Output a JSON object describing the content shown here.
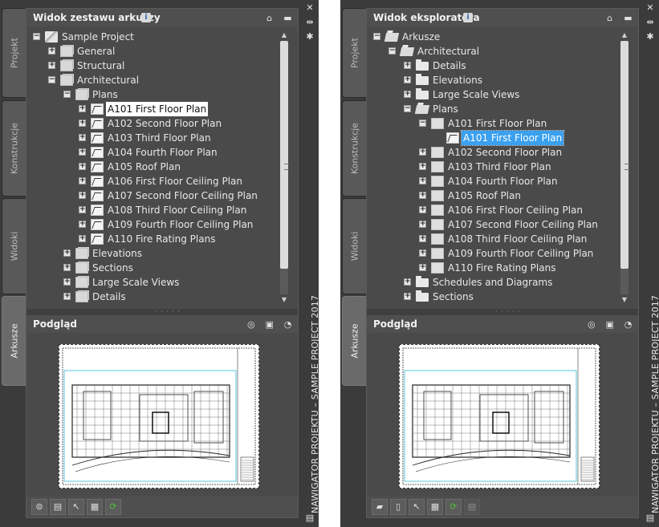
{
  "left": {
    "side_tabs": [
      "Projekt",
      "Konstrukcje",
      "Widoki",
      "Arkusze"
    ],
    "active_tab": "Arkusze",
    "title_vertical": "NAWIGATOR PROJEKTU – SAMPLE PROJECT 2017",
    "sheetset_panel": {
      "title": "Widok zestawu arkuszy",
      "info": "i",
      "tree": [
        {
          "label": "Sample Project",
          "icon": "sheetset-icon",
          "expanded": true
        },
        {
          "label": "General",
          "icon": "subset-icon",
          "expanded": false
        },
        {
          "label": "Structural",
          "icon": "subset-icon",
          "expanded": false
        },
        {
          "label": "Architectural",
          "icon": "subset-icon",
          "expanded": true
        },
        {
          "label": "Plans",
          "icon": "subset-icon",
          "expanded": true
        },
        {
          "label": "A101 First Floor Plan",
          "icon": "sheet-icon",
          "expanded": false,
          "selected": true
        },
        {
          "label": "A102 Second Floor Plan",
          "icon": "sheet-icon",
          "expanded": false
        },
        {
          "label": "A103 Third Floor Plan",
          "icon": "sheet-icon",
          "expanded": false
        },
        {
          "label": "A104 Fourth Floor Plan",
          "icon": "sheet-icon",
          "expanded": false
        },
        {
          "label": "A105 Roof Plan",
          "icon": "sheet-icon",
          "expanded": false
        },
        {
          "label": "A106 First Floor Ceiling Plan",
          "icon": "sheet-icon",
          "expanded": false
        },
        {
          "label": "A107 Second Floor Ceiling Plan",
          "icon": "sheet-icon",
          "expanded": false
        },
        {
          "label": "A108 Third Floor Ceiling Plan",
          "icon": "sheet-icon",
          "expanded": false
        },
        {
          "label": "A109 Fourth Floor Ceiling Plan",
          "icon": "sheet-icon",
          "expanded": false
        },
        {
          "label": "A110 Fire Rating Plans",
          "icon": "sheet-icon",
          "expanded": false
        },
        {
          "label": "Elevations",
          "icon": "subset-icon",
          "expanded": false
        },
        {
          "label": "Sections",
          "icon": "subset-icon",
          "expanded": false
        },
        {
          "label": "Large Scale Views",
          "icon": "subset-icon",
          "expanded": false
        },
        {
          "label": "Details",
          "icon": "subset-icon",
          "expanded": false
        }
      ]
    },
    "preview_panel": {
      "title": "Podgląd"
    }
  },
  "right": {
    "side_tabs": [
      "Projekt",
      "Konstrukcje",
      "Widoki",
      "Arkusze"
    ],
    "active_tab": "Arkusze",
    "title_vertical": "NAWIGATOR PROJEKTU – SAMPLE PROJECT 2017",
    "explorer_panel": {
      "title": "Widok eksploratora",
      "info": "i",
      "tree": [
        {
          "label": "Arkusze",
          "icon": "folder-open-icon",
          "expanded": true
        },
        {
          "label": "Architectural",
          "icon": "folder-open-icon",
          "expanded": true
        },
        {
          "label": "Details",
          "icon": "folder-icon",
          "expanded": false
        },
        {
          "label": "Elevations",
          "icon": "folder-icon",
          "expanded": false
        },
        {
          "label": "Large Scale Views",
          "icon": "folder-icon",
          "expanded": false
        },
        {
          "label": "Plans",
          "icon": "folder-open-icon",
          "expanded": true
        },
        {
          "label": "A101 First Floor Plan",
          "icon": "sheet-node-icon",
          "expanded": true
        },
        {
          "label": "A101 First Floor Plan",
          "icon": "sheet-icon",
          "selected": true
        },
        {
          "label": "A102 Second Floor Plan",
          "icon": "sheet-node-icon",
          "expanded": false
        },
        {
          "label": "A103 Third Floor Plan",
          "icon": "sheet-node-icon",
          "expanded": false
        },
        {
          "label": "A104 Fourth Floor Plan",
          "icon": "sheet-node-icon",
          "expanded": false
        },
        {
          "label": "A105 Roof Plan",
          "icon": "sheet-node-icon",
          "expanded": false
        },
        {
          "label": "A106 First Floor Ceiling Plan",
          "icon": "sheet-node-icon",
          "expanded": false
        },
        {
          "label": "A107 Second Floor Ceiling Plan",
          "icon": "sheet-node-icon",
          "expanded": false
        },
        {
          "label": "A108 Third Floor Ceiling Plan",
          "icon": "sheet-node-icon",
          "expanded": false
        },
        {
          "label": "A109 Fourth Floor Ceiling Plan",
          "icon": "sheet-node-icon",
          "expanded": false
        },
        {
          "label": "A110 Fire Rating Plans",
          "icon": "sheet-node-icon",
          "expanded": false
        },
        {
          "label": "Schedules and Diagrams",
          "icon": "folder-icon",
          "expanded": false
        },
        {
          "label": "Sections",
          "icon": "folder-icon",
          "expanded": false
        }
      ]
    },
    "preview_panel": {
      "title": "Podgląd"
    }
  },
  "colors": {
    "selection_blue": "#3aa0f0",
    "viewport_cyan": "#2fb7d6"
  }
}
